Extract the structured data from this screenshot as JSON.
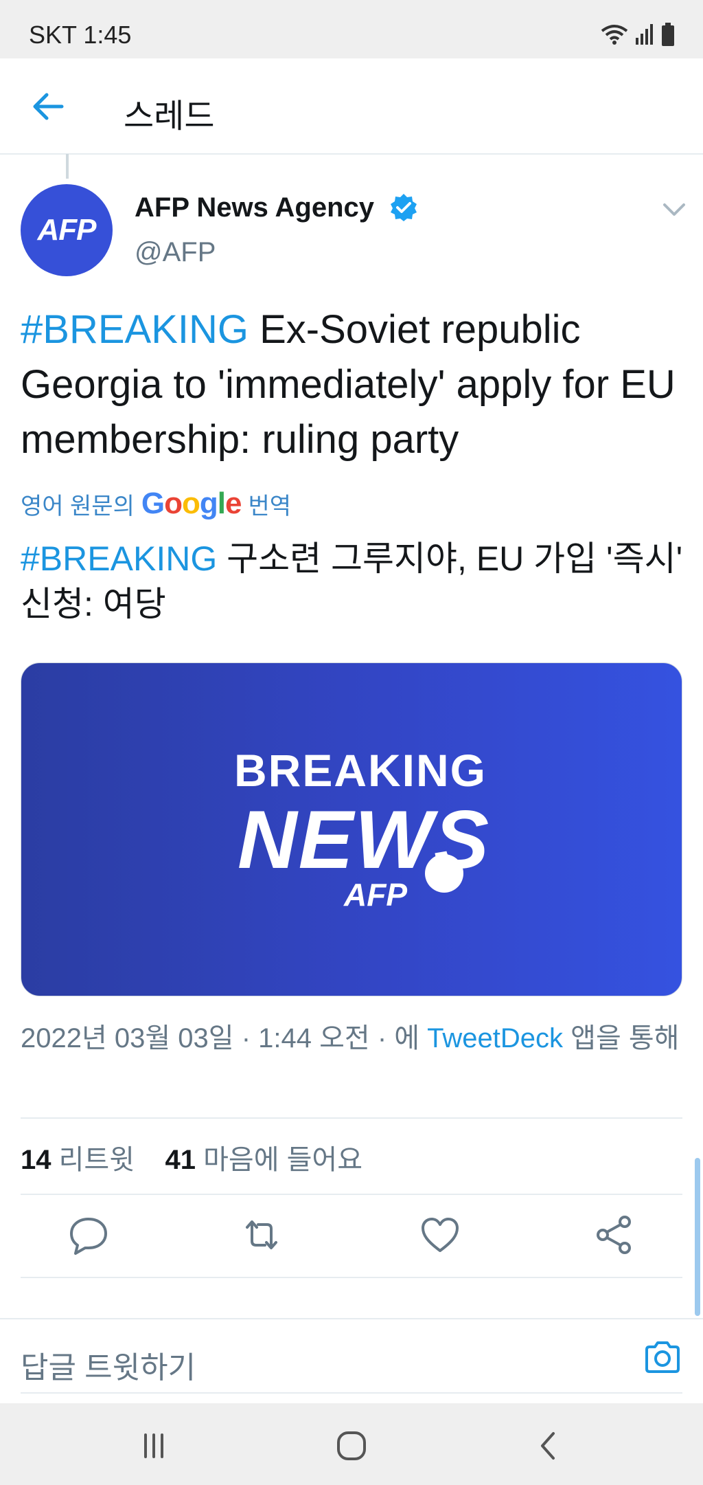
{
  "status_bar": {
    "carrier_time": "SKT 1:45",
    "icons": [
      "wifi-icon",
      "signal-icon",
      "battery-icon"
    ]
  },
  "header": {
    "back_icon": "arrow-left-icon",
    "title": "스레드"
  },
  "tweet": {
    "author_name": "AFP News Agency",
    "author_handle": "@AFP",
    "avatar_text": "AFP",
    "verified_icon": "verified-badge-icon",
    "hashtag": "#BREAKING",
    "text": " Ex-Soviet republic Georgia to 'immediately' apply for EU membership: ruling party",
    "translate_prefix": "영어 원문의",
    "translate_brand": "Google",
    "translate_suffix": "번역",
    "translated_hashtag": "#BREAKING",
    "translated_text": " 구소련 그루지야, EU 가입 '즉시' 신청: 여당",
    "media": {
      "line1": "BREAKING",
      "line2": "NEWS",
      "brand": "AFP"
    },
    "meta_prefix": "2022년 03월 03일 · 1:44 오전 · 에 ",
    "meta_link": "TweetDeck",
    "meta_suffix": " 앱을 통해",
    "retweet_count": "14",
    "retweet_label": "리트윗",
    "like_count": "41",
    "like_label": "마음에 들어요"
  },
  "actions": [
    "reply-icon",
    "retweet-icon",
    "like-icon",
    "share-icon"
  ],
  "reply_bar": {
    "placeholder": "답글 트윗하기",
    "camera_icon": "camera-icon"
  },
  "nav_bar": [
    "recent-apps-icon",
    "home-icon",
    "back-icon"
  ],
  "colors": {
    "accent": "#1b95e0",
    "text": "#14171a",
    "muted": "#657786",
    "avatar_bg": "#3650d8"
  }
}
